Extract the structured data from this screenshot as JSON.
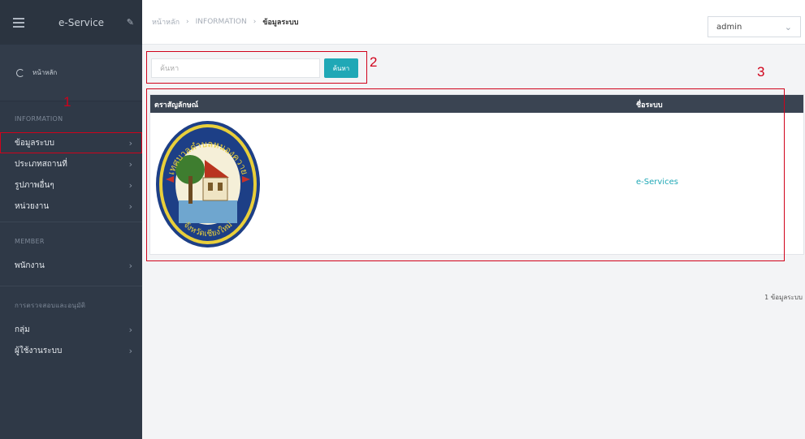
{
  "sidebar": {
    "brand": "e-Service",
    "home_label": "หน้าหลัก",
    "sections": [
      {
        "heading": "INFORMATION",
        "items": [
          "ข้อมูลระบบ",
          "ประเภทสถานที่",
          "รูปภาพอื่นๆ",
          "หน่วยงาน"
        ]
      },
      {
        "heading": "MEMBER",
        "items": [
          "พนักงาน"
        ]
      },
      {
        "heading": "การตรวจสอบและอนุมัติ",
        "items": [
          "กลุ่ม",
          "ผู้ใช้งานระบบ"
        ]
      }
    ]
  },
  "topbar": {
    "breadcrumb": [
      "หน้าหลัก",
      "INFORMATION",
      "ข้อมูลระบบ"
    ],
    "user": "admin"
  },
  "search": {
    "placeholder": "ค้นหา",
    "button_label": "ค้นหา"
  },
  "table": {
    "columns": [
      "ตราสัญลักษณ์",
      "ชื่อระบบ"
    ],
    "rows": [
      {
        "name": "e-Services",
        "seal_text_top": "เทศบาลตำบลหนองควาย",
        "seal_text_bottom": "จังหวัดเชียงใหม่"
      }
    ]
  },
  "count_text": "1 ข้อมูลระบบ",
  "annotations": [
    "1",
    "2",
    "3"
  ],
  "colors": {
    "accent": "#20a8b6",
    "sidebar": "#2f3947",
    "annotation": "#d0021b"
  }
}
